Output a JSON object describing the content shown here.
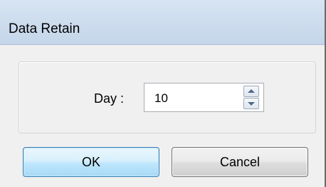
{
  "window": {
    "title": "Data Retain"
  },
  "form": {
    "day_label": "Day :",
    "day_value": "10"
  },
  "buttons": {
    "ok_label": "OK",
    "cancel_label": "Cancel"
  }
}
